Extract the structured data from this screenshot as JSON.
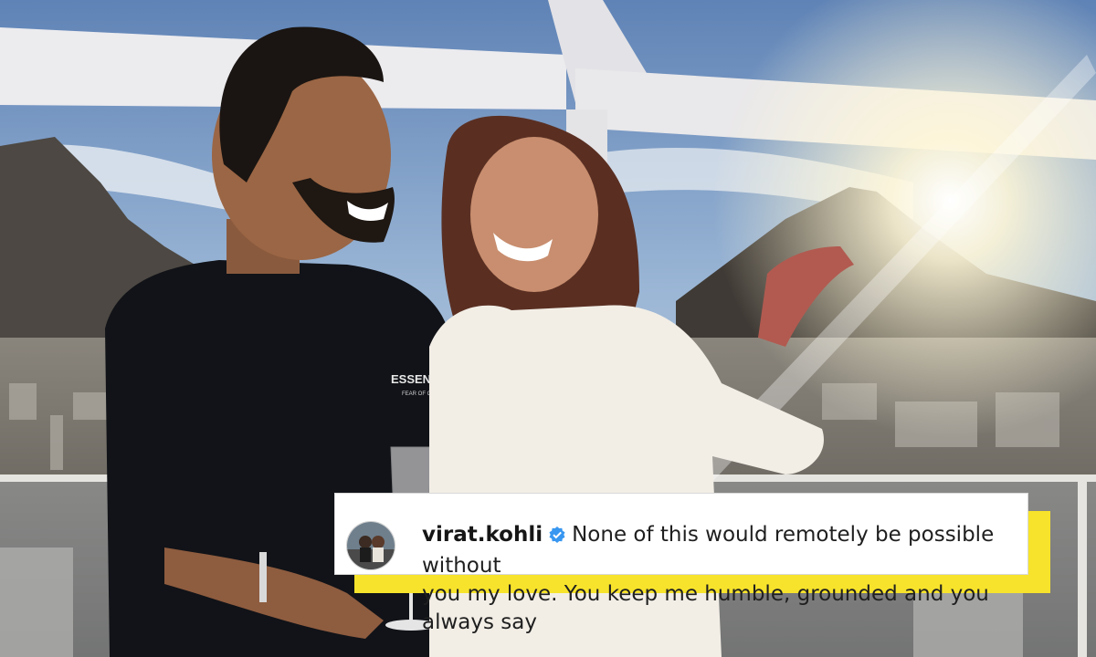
{
  "scene": {
    "description_icon": "photo-scene-couple-balcony-sunset",
    "colors": {
      "sky_top": "#5f83b6",
      "sky_mid": "#9cb7d6",
      "sun_glow": "#fff7d8",
      "mountain": "#4a4540",
      "city": "#6f6d6a",
      "canopy": "#e9e8ea",
      "man_shirt": "#111318",
      "woman_dress": "#f2eee6"
    }
  },
  "caption": {
    "username": "virat.kohli",
    "verified_icon": "verified-badge-icon",
    "line1": "None of this would remotely be possible without",
    "line2": "you my love. You keep me humble, grounded and you always say",
    "accent_color": "#f7e32b"
  },
  "shirt": {
    "print_line1": "ESSENTIALS",
    "print_line2": "FEAR OF GOD"
  }
}
